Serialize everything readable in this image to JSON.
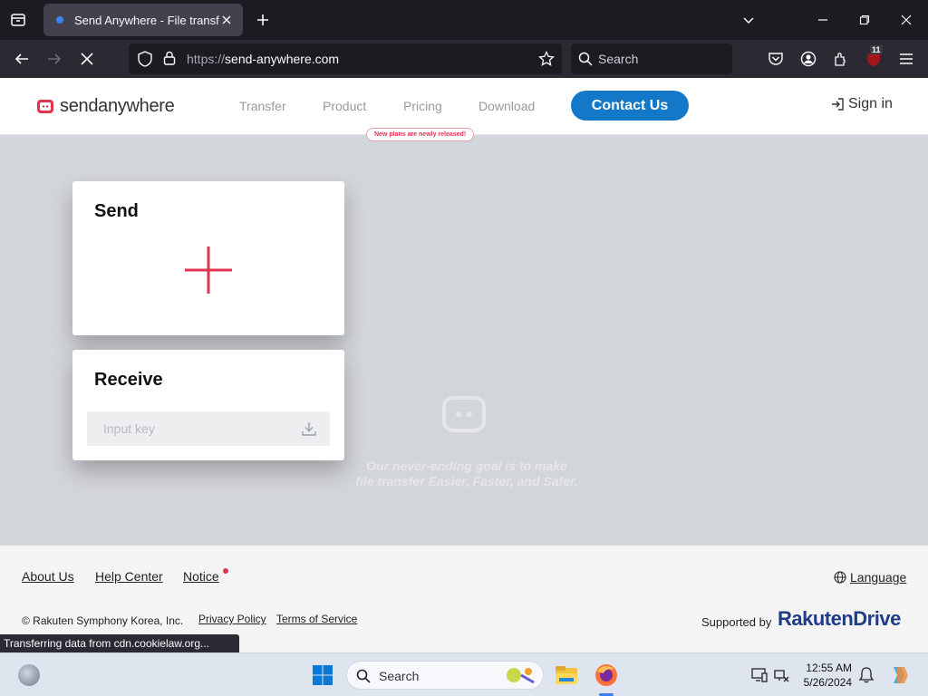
{
  "browser": {
    "tab_title": "Send Anywhere - File transfer",
    "url_proto": "https://",
    "url_host": "send-anywhere.com",
    "search_placeholder": "Search",
    "extension_badge": "11"
  },
  "site": {
    "logo_text_a": "send",
    "logo_text_b": "anywhere",
    "menu": [
      "Transfer",
      "Product",
      "Pricing",
      "Download"
    ],
    "new_plans_badge": "New plans are newly released!",
    "contact_label": "Contact Us",
    "signin_label": "Sign in",
    "brand_color": "#e0344f",
    "accent_color": "#1478c8"
  },
  "send_card": {
    "title": "Send"
  },
  "receive_card": {
    "title": "Receive",
    "input_placeholder": "Input key"
  },
  "hero": {
    "tagline_line1": "Our never-ending goal is to make",
    "tagline_line2": "file transfer Easier, Faster, and Safer."
  },
  "footer": {
    "about": "About Us",
    "help": "Help Center",
    "notice": "Notice",
    "language": "Language",
    "copyright": "© Rakuten Symphony Korea, Inc.",
    "privacy": "Privacy Policy",
    "terms": "Terms of Service",
    "supported_by": "Supported by",
    "rakuten_a": "Rakuten",
    "rakuten_b": "Drive"
  },
  "status_text": "Transferring data from cdn.cookielaw.org...",
  "taskbar": {
    "search_label": "Search",
    "time": "12:55 AM",
    "date": "5/26/2024"
  }
}
